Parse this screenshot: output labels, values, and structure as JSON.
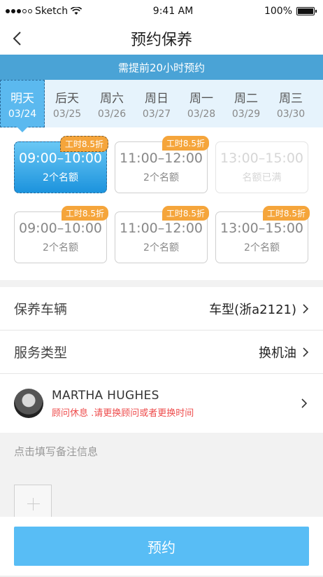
{
  "status_bar": {
    "carrier": "Sketch",
    "time": "9:41 AM",
    "battery": "100%"
  },
  "nav": {
    "title": "预约保养"
  },
  "notice": "需提前20小时预约",
  "days": [
    {
      "name": "明天",
      "date": "03/24",
      "selected": true
    },
    {
      "name": "后天",
      "date": "03/25"
    },
    {
      "name": "周六",
      "date": "03/26"
    },
    {
      "name": "周日",
      "date": "03/27"
    },
    {
      "name": "周一",
      "date": "03/28"
    },
    {
      "name": "周二",
      "date": "03/29"
    },
    {
      "name": "周三",
      "date": "03/30"
    }
  ],
  "slots": [
    {
      "time": "09:00–10:00",
      "count": "2个名额",
      "badge": "工时8.5折",
      "state": "selected"
    },
    {
      "time": "11:00–12:00",
      "count": "2个名额",
      "badge": "工时8.5折",
      "state": "available"
    },
    {
      "time": "13:00–15:00",
      "count": "名额已满",
      "badge": "",
      "state": "full"
    },
    {
      "time": "09:00–10:00",
      "count": "2个名额",
      "badge": "工时8.5折",
      "state": "available"
    },
    {
      "time": "11:00–12:00",
      "count": "2个名额",
      "badge": "工时8.5折",
      "state": "available"
    },
    {
      "time": "13:00–15:00",
      "count": "2个名额",
      "badge": "工时8.5折",
      "state": "available"
    }
  ],
  "vehicle": {
    "label": "保养车辆",
    "value": "车型(浙a2121)"
  },
  "service": {
    "label": "服务类型",
    "value": "换机油"
  },
  "advisor": {
    "name": "MARTHA HUGHES",
    "warning": "顾问休息 .请更换顾问或者更换时间"
  },
  "note": {
    "placeholder": "点击填写备注信息"
  },
  "submit_label": "预约",
  "colors": {
    "accent": "#58bdf5",
    "notice_bg": "#4aa3d6",
    "badge": "#f5a53b",
    "warning": "#ee4c4c"
  }
}
